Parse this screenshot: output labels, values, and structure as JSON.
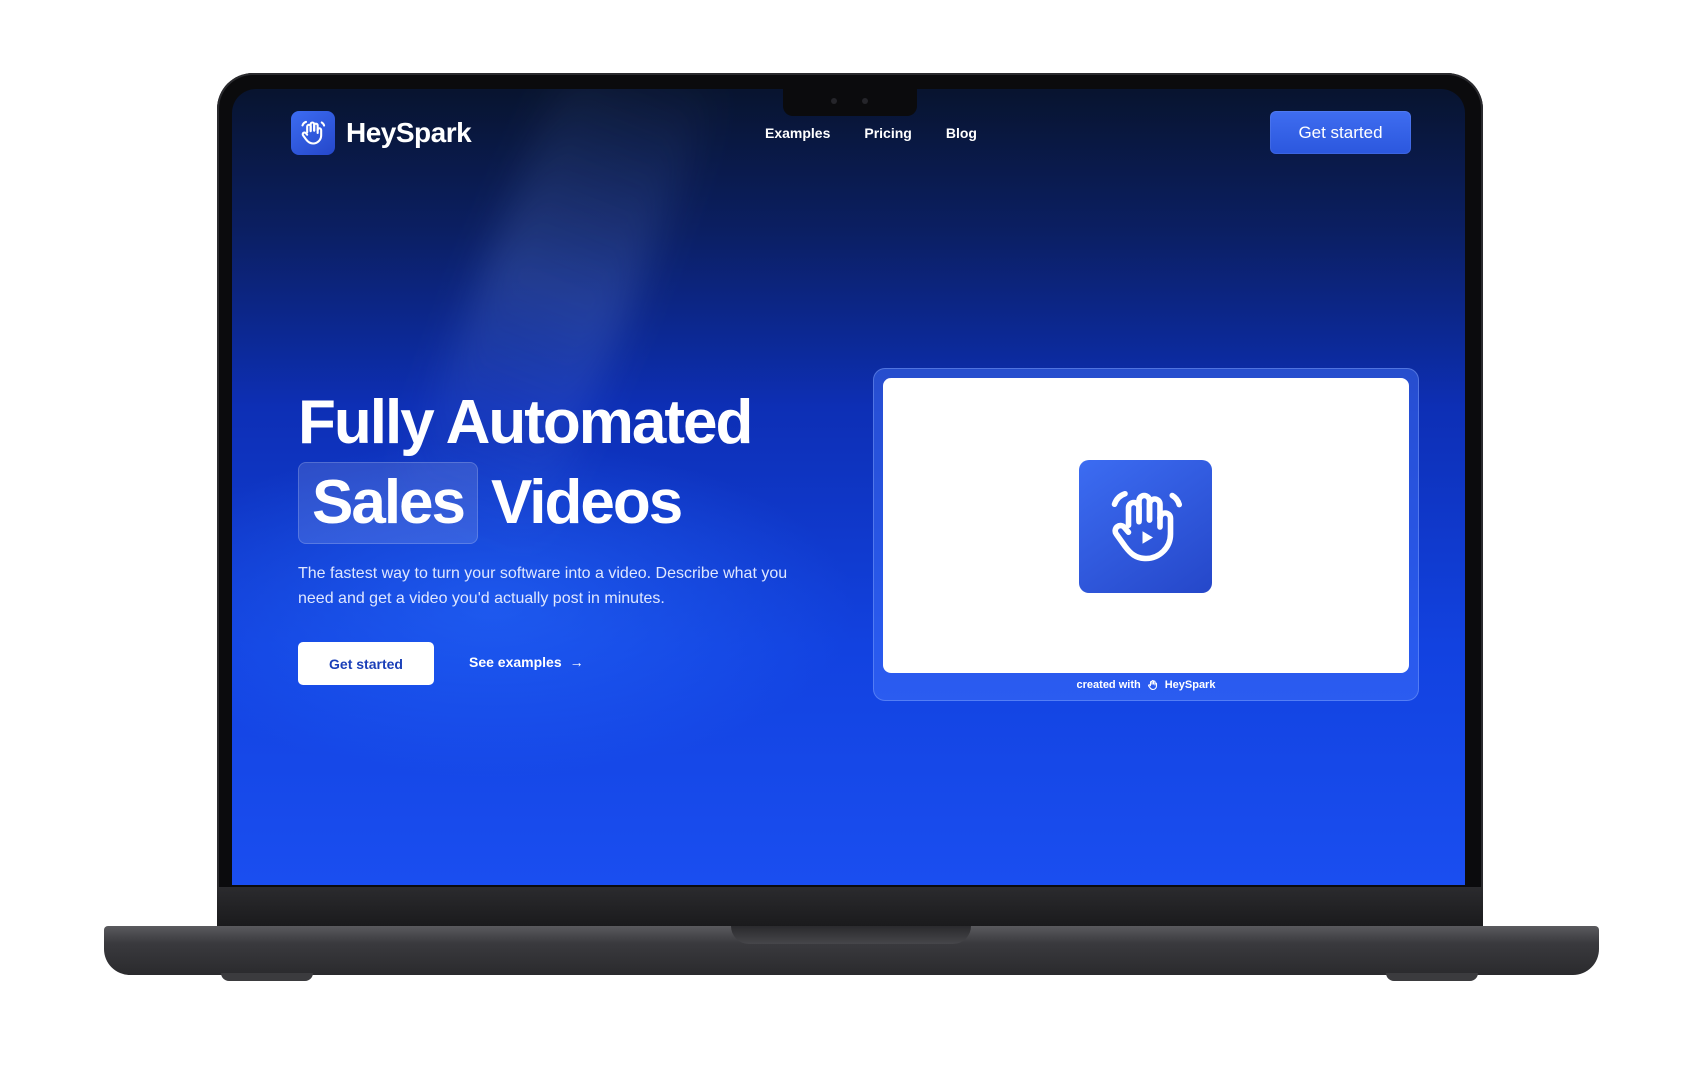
{
  "brand": {
    "name": "HeySpark",
    "logo_icon": "waving-hand-icon"
  },
  "nav": {
    "items": [
      "Examples",
      "Pricing",
      "Blog"
    ],
    "cta": "Get started"
  },
  "hero": {
    "title_line1": "Fully Automated",
    "title_highlight": "Sales",
    "title_rest": "Videos",
    "subtitle": "The fastest way to turn your software into a video. Describe what you need and get a video you'd actually post in minutes.",
    "primary_cta": "Get started",
    "secondary_cta": "See examples",
    "secondary_icon": "arrow-right-icon"
  },
  "video_card": {
    "center_icon": "waving-hand-play-icon",
    "caption_prefix": "created with",
    "caption_brand": "HeySpark"
  },
  "colors": {
    "accent": "#2f5be0",
    "screen_top": "#08142f",
    "screen_bottom": "#1a4ef0"
  }
}
